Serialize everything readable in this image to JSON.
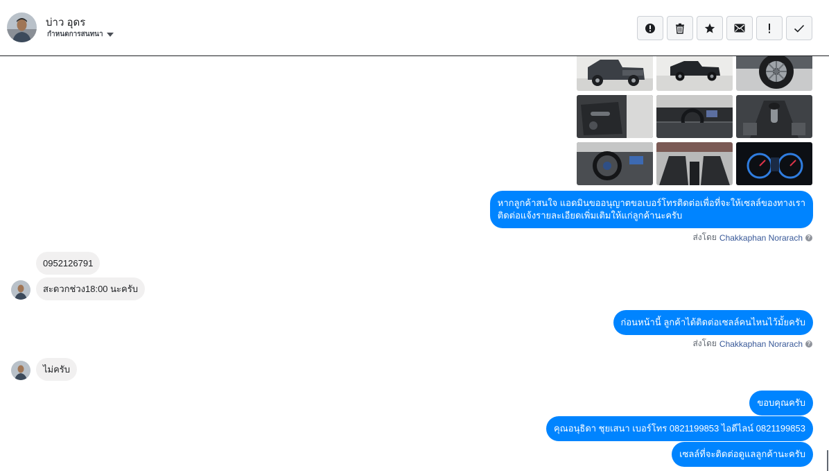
{
  "header": {
    "contact_name": "บ่าว อุดร",
    "assign_label": "กำหนดการสนทนา",
    "actions": [
      {
        "icon": "alert-circle-icon",
        "label": "Mark as spam"
      },
      {
        "icon": "trash-icon",
        "label": "Delete"
      },
      {
        "icon": "star-icon",
        "label": "Star"
      },
      {
        "icon": "envelope-icon",
        "label": "Mark as unread"
      },
      {
        "icon": "exclamation-icon",
        "label": "Follow up"
      },
      {
        "icon": "check-icon",
        "label": "Mark as done"
      }
    ]
  },
  "photos": {
    "count": 9,
    "subjects": [
      "pickup-truck-rear",
      "pickup-truck-side",
      "wheel",
      "door-interior",
      "dashboard",
      "gear-shift",
      "steering-wheel",
      "cabin-interior",
      "instrument-cluster"
    ]
  },
  "messages": [
    {
      "id": "m1",
      "direction": "out",
      "lines": [
        "หากลูกค้าสนใจ แอดมินขออนุญาตขอเบอร์โทรติดต่อเพื่อที่จะให้เซลล์ของทางเรา",
        "ติดต่อแจ้งรายละเอียดเพิ่มเติมให้แก่ลูกค้านะครับ"
      ]
    },
    {
      "id": "m2",
      "direction": "in",
      "text": "0952126791"
    },
    {
      "id": "m3",
      "direction": "in",
      "text": "สะดวกช่วง18:00 นะครับ"
    },
    {
      "id": "m4",
      "direction": "out",
      "text": "ก่อนหน้านี้ ลูกค้าได้ติดต่อเซลล์คนไหนไว้มั้ยครับ"
    },
    {
      "id": "m5",
      "direction": "in",
      "text": "ไม่ครับ"
    },
    {
      "id": "m6",
      "direction": "out",
      "text": "ขอบคุณครับ"
    },
    {
      "id": "m7",
      "direction": "out",
      "text": "คุณอนุธิดา ชุยเสนา        เบอร์โทร 0821199853  ไอดีไลน์ 0821199853"
    },
    {
      "id": "m8",
      "direction": "out",
      "text": "เซลล์ที่จะติดต่อดูแลลูกค้านะครับ"
    }
  ],
  "sent_by": {
    "prefix": "ส่งโดย",
    "agent": "Chakkaphan Norarach",
    "help_glyph": "?"
  },
  "colors": {
    "outgoing_bubble": "#0084ff",
    "incoming_bubble": "#f1f0f0",
    "agent_link": "#385898"
  }
}
